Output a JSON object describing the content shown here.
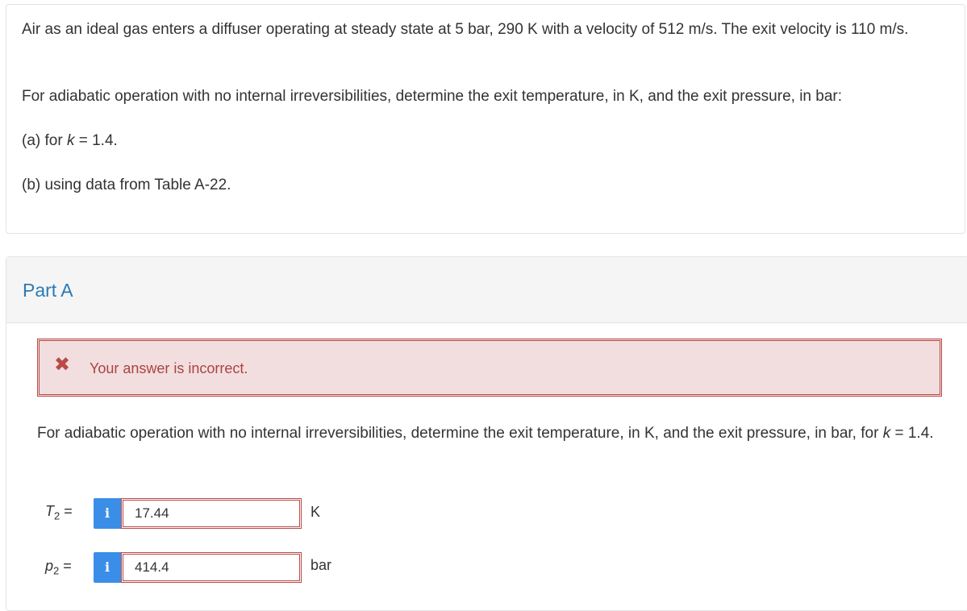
{
  "question": {
    "line1": "Air as an ideal gas enters a diffuser operating at steady state at 5 bar, 290 K with a velocity of 512 m/s. The exit velocity is 110 m/s.",
    "line2": "For adiabatic operation with no internal irreversibilities, determine the exit temperature, in K, and the exit pressure, in bar:",
    "item_a_prefix": "(a) for ",
    "item_a_var": "k",
    "item_a_suffix": " = 1.4.",
    "item_b": "(b) using data from Table A-22."
  },
  "part": {
    "title": "Part A",
    "feedback": {
      "icon": "close-icon",
      "text": "Your answer is incorrect.",
      "color": "#a94442",
      "background": "#f2dede"
    },
    "prompt_text": "For adiabatic operation with no internal irreversibilities, determine the exit temperature, in K, and the exit pressure, in bar, for ",
    "prompt_var": "k",
    "prompt_suffix": " = 1.4.",
    "answers": [
      {
        "var": "T",
        "sub": "2",
        "eq": " =",
        "info_icon": "info-icon",
        "info_label": "i",
        "value": "17.44",
        "unit": "K"
      },
      {
        "var": "p",
        "sub": "2",
        "eq": " =",
        "info_icon": "info-icon",
        "info_label": "i",
        "value": "414.4",
        "unit": "bar"
      }
    ]
  },
  "colors": {
    "accent_blue": "#2a7ab8",
    "info_button": "#3b8ee8",
    "error_border": "#b94a48"
  }
}
